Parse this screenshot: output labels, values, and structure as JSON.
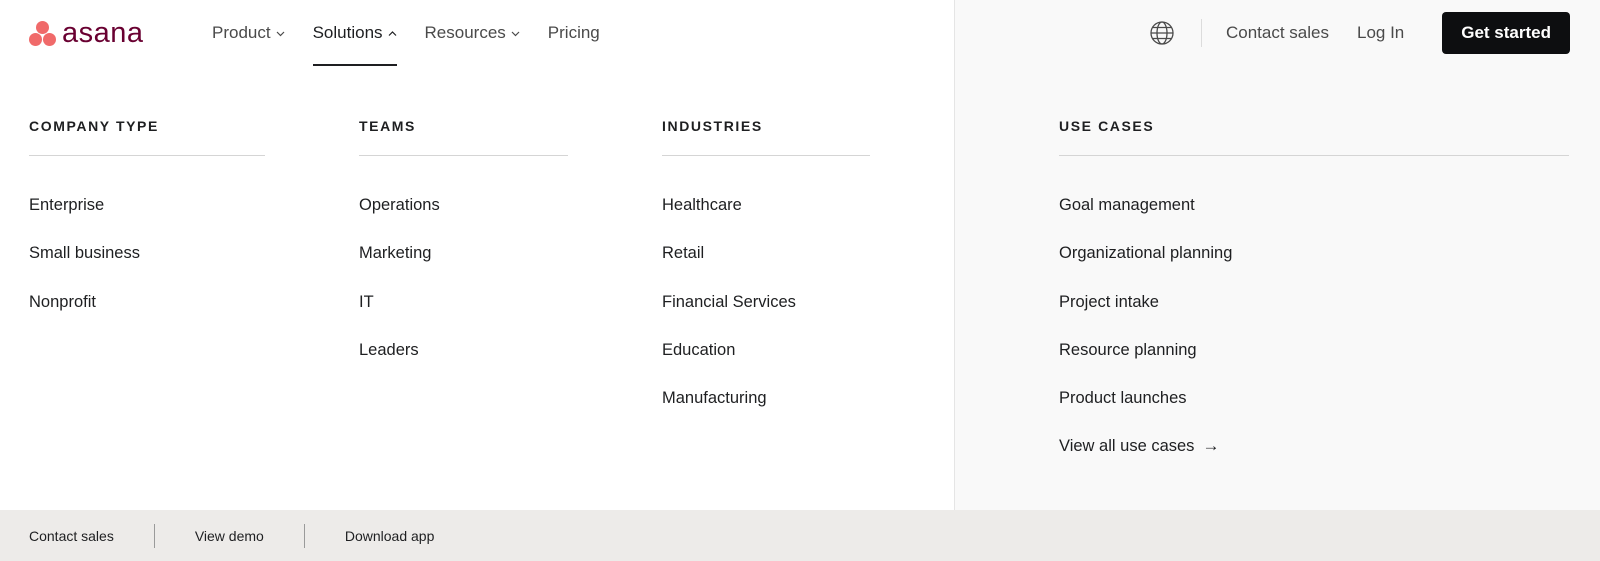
{
  "brand": {
    "name": "asana",
    "dot_color": "#f06a6a",
    "text_color": "#690031"
  },
  "nav": {
    "items": [
      {
        "label": "Product",
        "has_chevron": true,
        "active": false
      },
      {
        "label": "Solutions",
        "has_chevron": true,
        "active": true
      },
      {
        "label": "Resources",
        "has_chevron": true,
        "active": false
      },
      {
        "label": "Pricing",
        "has_chevron": false,
        "active": false
      }
    ]
  },
  "header_right": {
    "globe_icon": "globe-icon",
    "contact_sales": "Contact sales",
    "log_in": "Log In",
    "get_started": "Get started",
    "cta_color": "#0d0e10"
  },
  "columns": {
    "company_type": {
      "title": "COMPANY TYPE",
      "items": [
        "Enterprise",
        "Small business",
        "Nonprofit"
      ]
    },
    "teams": {
      "title": "TEAMS",
      "items": [
        "Operations",
        "Marketing",
        "IT",
        "Leaders"
      ]
    },
    "industries": {
      "title": "INDUSTRIES",
      "items": [
        "Healthcare",
        "Retail",
        "Financial Services",
        "Education",
        "Manufacturing"
      ]
    },
    "use_cases": {
      "title": "USE CASES",
      "items": [
        "Goal management",
        "Organizational planning",
        "Project intake",
        "Resource planning",
        "Product launches"
      ],
      "view_all": "View all use cases",
      "view_all_icon": "arrow-right-icon"
    }
  },
  "footer": {
    "contact_sales": "Contact sales",
    "view_demo": "View demo",
    "download_app": "Download app",
    "background": "#edebe9"
  }
}
